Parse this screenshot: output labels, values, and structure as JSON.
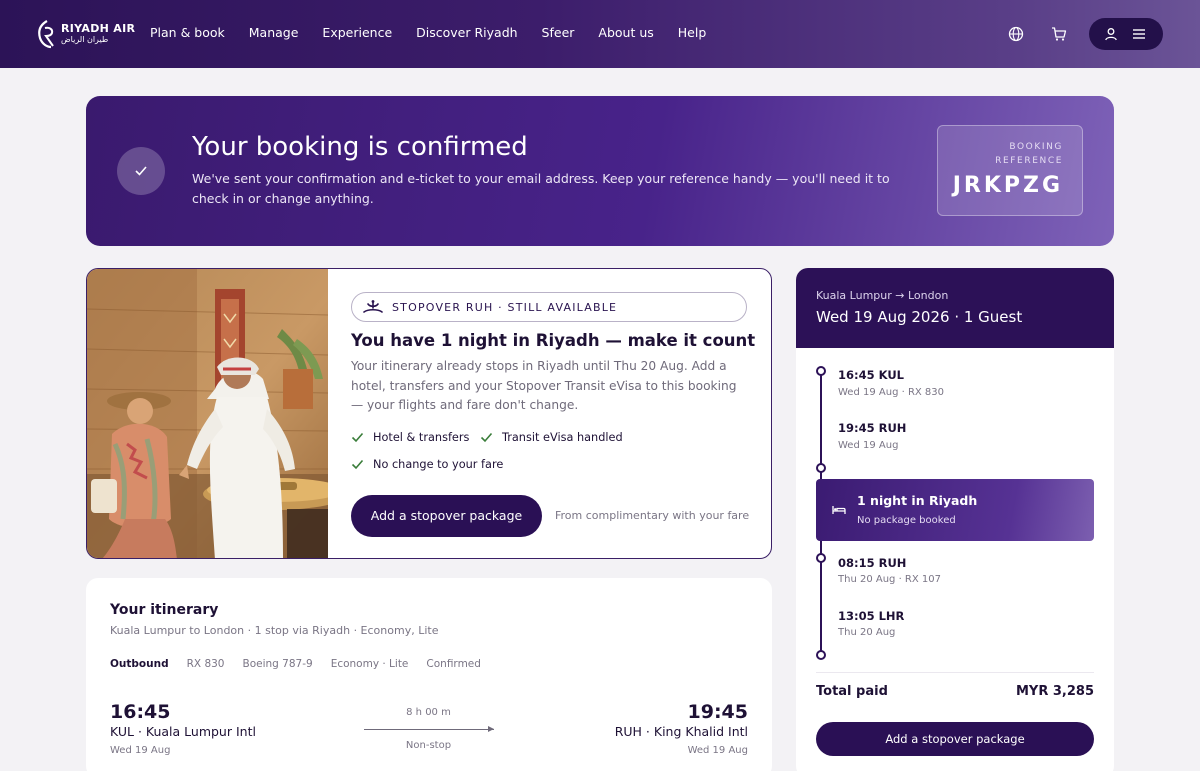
{
  "brand": {
    "name_en": "RIYADH AIR",
    "name_ar": "طيران الرياض"
  },
  "nav": {
    "links": [
      "Plan & book",
      "Manage",
      "Experience",
      "Discover Riyadh",
      "Sfeer",
      "About us",
      "Help"
    ],
    "icons": [
      "globe-icon",
      "cart-icon",
      "user-icon",
      "menu-icon"
    ]
  },
  "banner": {
    "title": "Your booking is confirmed",
    "message": "We've sent your confirmation and e-ticket to your email address. Keep your reference handy — you'll need it to check in or change anything.",
    "reference_label": "BOOKING REFERENCE",
    "reference_code": "JRKPZG"
  },
  "stopover": {
    "pill": "STOPOVER RUH · STILL AVAILABLE",
    "title": "You have 1 night in Riyadh — make it count",
    "description": "Your itinerary already stops in Riyadh until Thu 20 Aug. Add a hotel, transfers and your Stopover Transit eVisa to this booking — your flights and fare don't change.",
    "features": [
      "Hotel & transfers",
      "Transit eVisa handled",
      "No change to your fare"
    ],
    "button": "Add a stopover package",
    "note": "From complimentary with your fare"
  },
  "itinerary": {
    "title": "Your itinerary",
    "subtitle": "Kuala Lumpur to London · 1 stop via Riyadh · Economy, Lite",
    "tabs": [
      "Outbound",
      "RX 830",
      "Boeing 787-9",
      "Economy · Lite",
      "Confirmed"
    ],
    "departure": {
      "time": "16:45",
      "airport": "KUL · Kuala Lumpur Intl",
      "date": "Wed 19 Aug"
    },
    "arrival": {
      "time": "19:45",
      "airport": "RUH · King Khalid Intl",
      "date": "Wed 19 Aug"
    },
    "duration": "8 h 00 m",
    "stops": "Non-stop"
  },
  "summary": {
    "route": "Kuala Lumpur → London",
    "date_guests": "Wed 19 Aug 2026 · 1 Guest",
    "timeline": [
      {
        "time": "16:45 KUL",
        "detail": "Wed 19 Aug · RX 830"
      },
      {
        "time": "19:45 RUH",
        "detail": "Wed 19 Aug"
      },
      {
        "time": "08:15 RUH",
        "detail": "Thu 20 Aug · RX 107"
      },
      {
        "time": "13:05 LHR",
        "detail": "Thu 20 Aug"
      }
    ],
    "stay": {
      "title": "1 night in Riyadh",
      "subtitle": "No package booked"
    },
    "total_label": "Total paid",
    "total_value": "MYR 3,285",
    "button": "Add a stopover package"
  },
  "colors": {
    "brand_dark": "#2c1157",
    "accent_purple": "#7e62b8",
    "check_green": "#3a7d3a"
  }
}
